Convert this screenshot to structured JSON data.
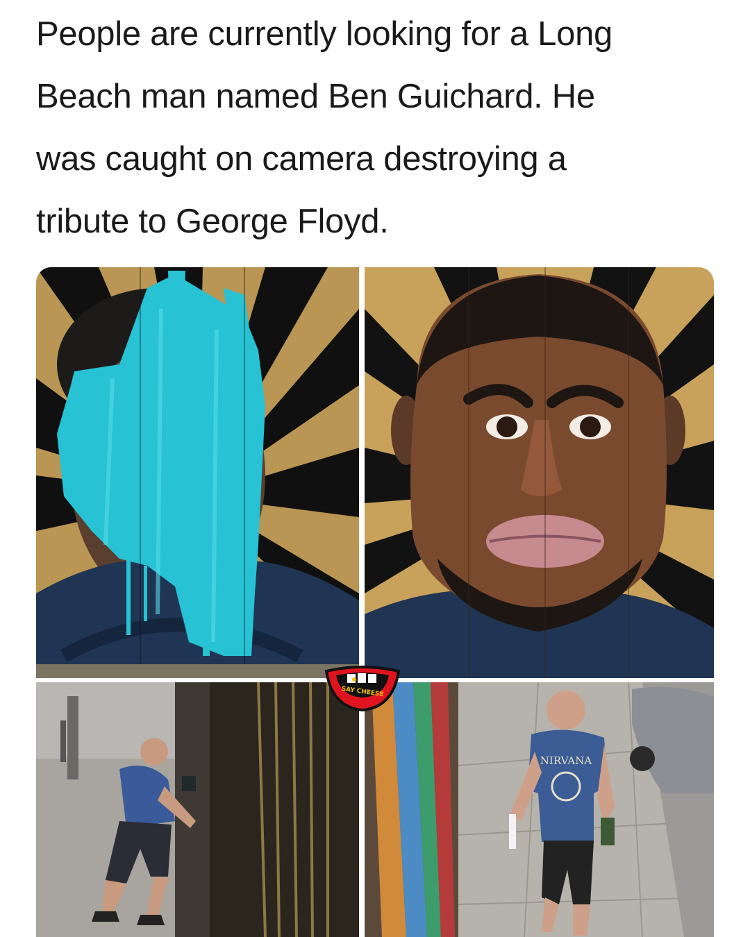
{
  "post": {
    "caption_lines": [
      "People are currently looking for a Long",
      "Beach man named Ben Guichard. He",
      "was caught on camera destroying a",
      "tribute to George Floyd."
    ]
  },
  "watermark": {
    "text": "SAY CHEESE",
    "colors": {
      "lips": "#e0141e",
      "outline": "#111111",
      "teeth": "#ffffff",
      "badge": "#f2c200"
    }
  },
  "shirt": {
    "text": "NIRVANA"
  },
  "colors": {
    "paint_turquoise": "#27c2d3",
    "mural_gold": "#c8a25b",
    "mural_black": "#111111",
    "shirt_navy": "#1f3553"
  }
}
